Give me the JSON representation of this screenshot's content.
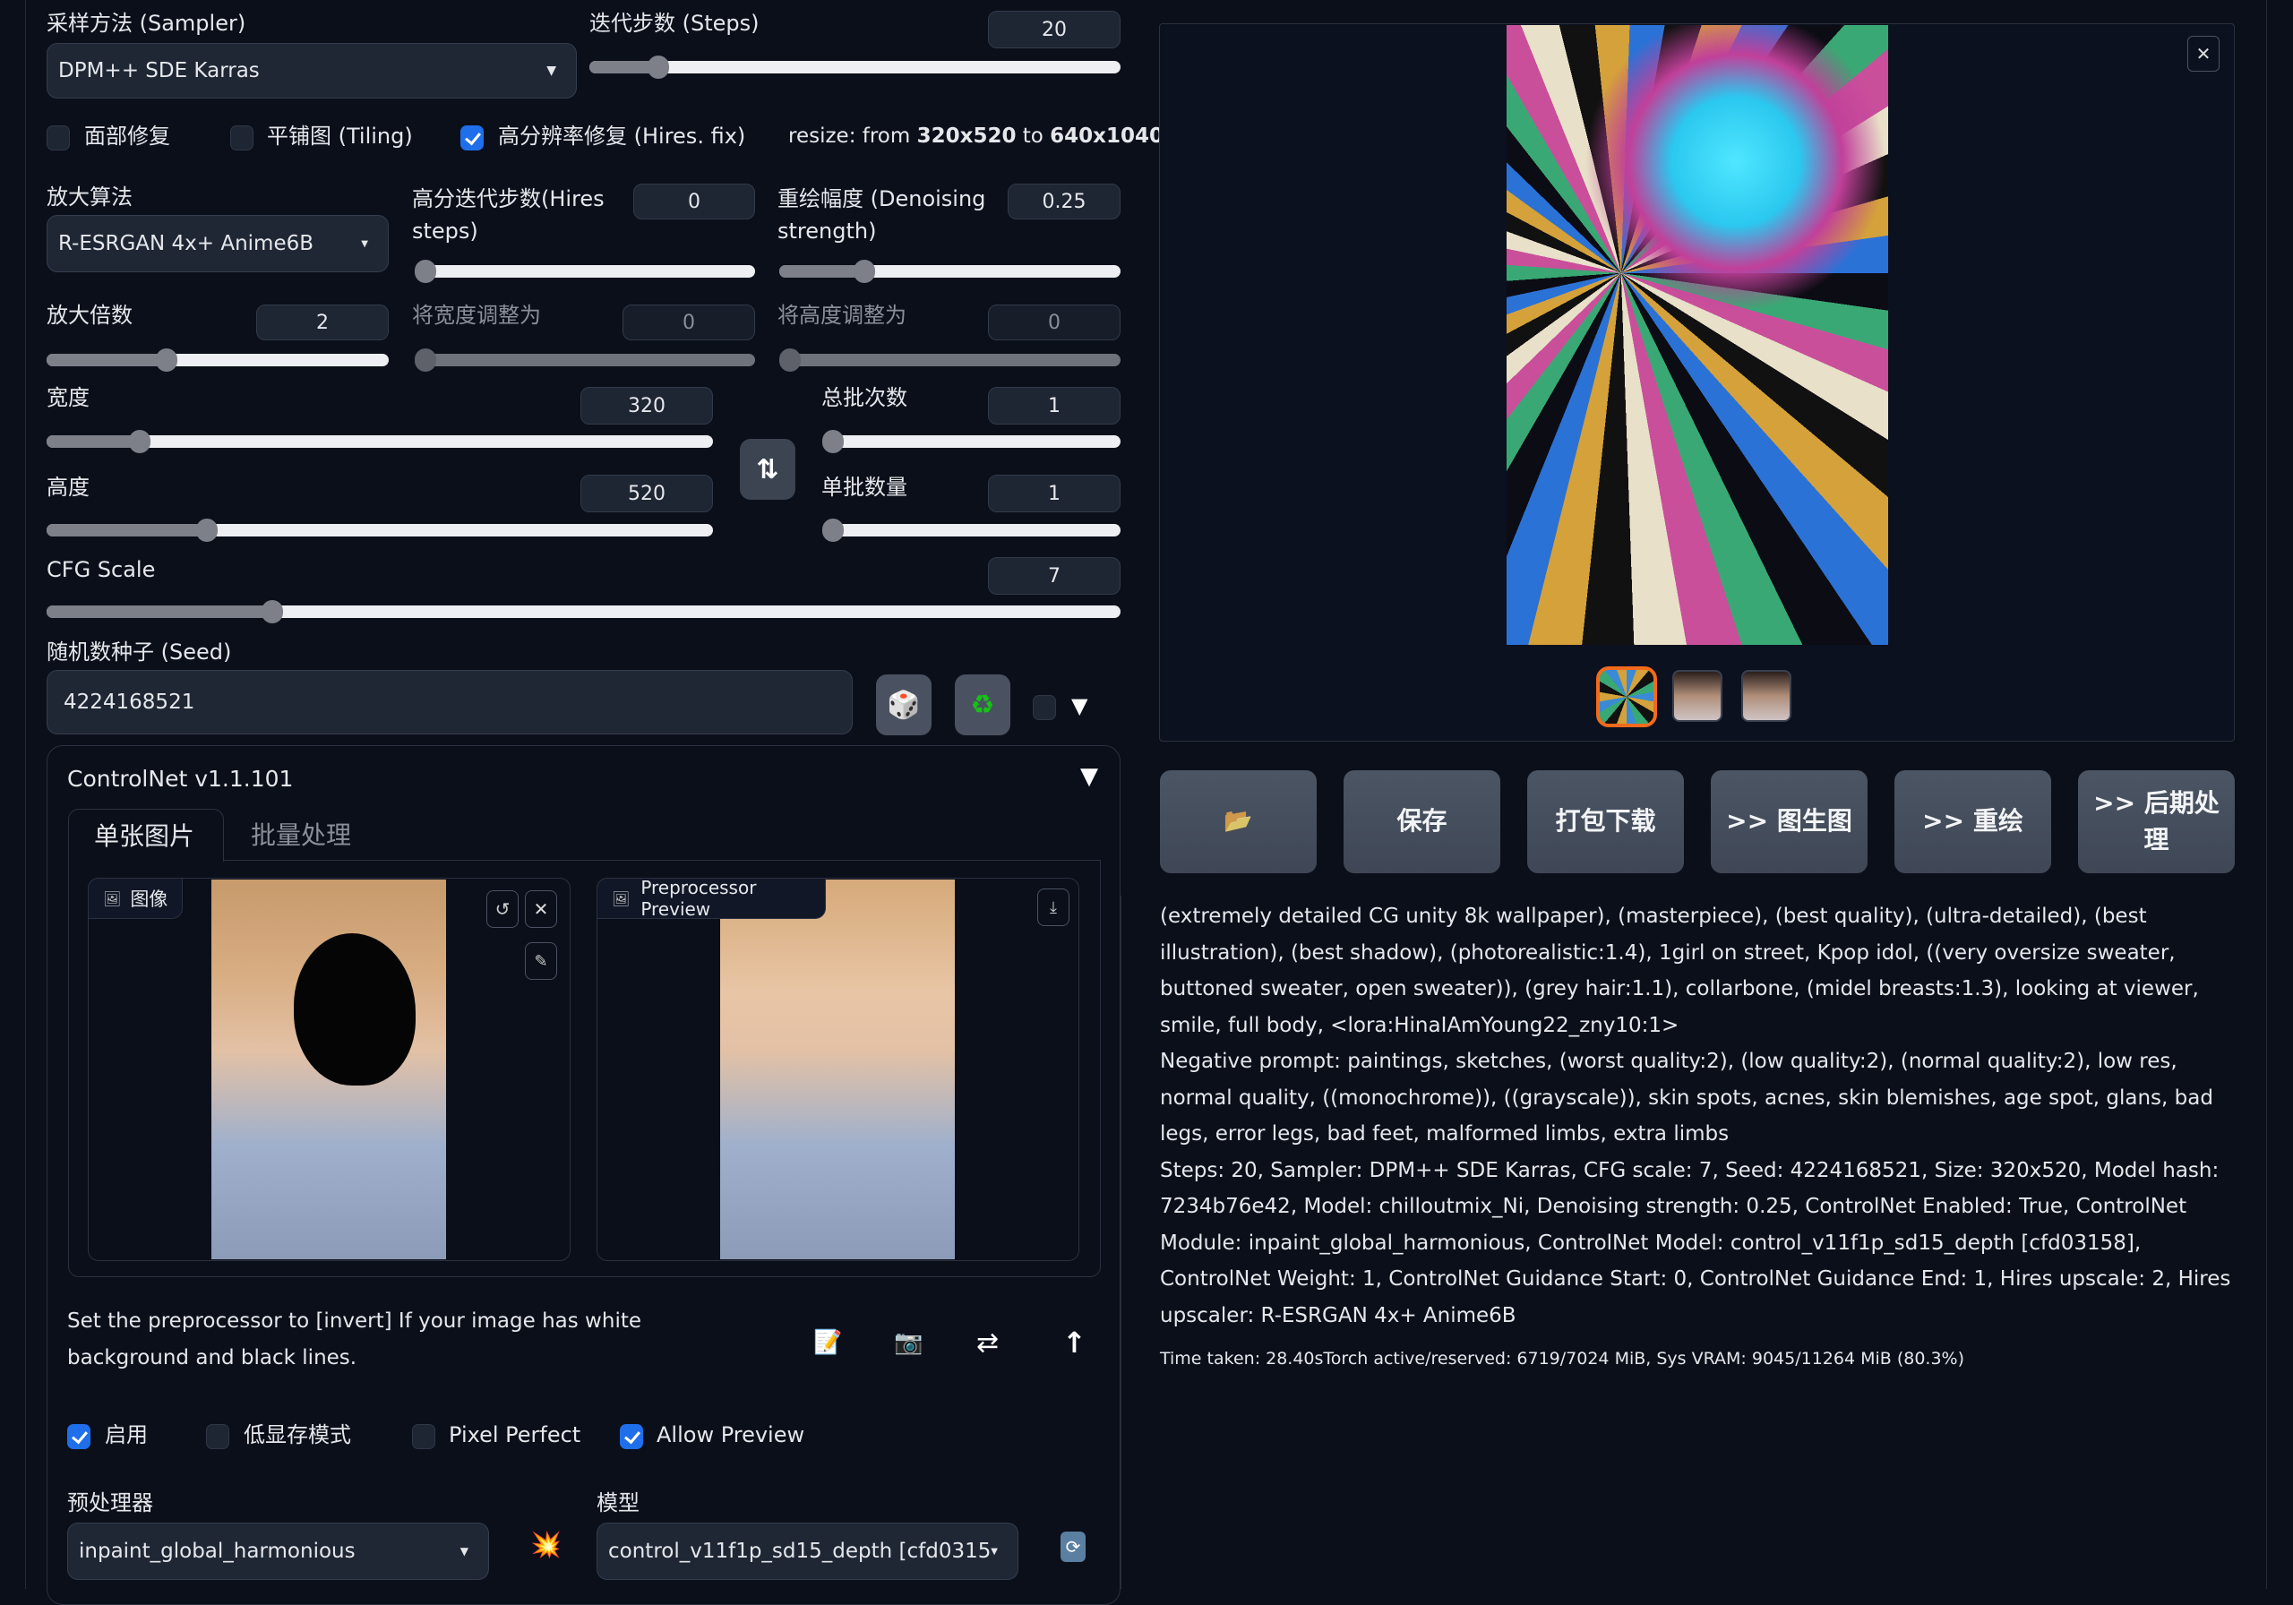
{
  "sampler": {
    "label": "采样方法 (Sampler)",
    "value": "DPM++ SDE Karras"
  },
  "steps": {
    "label": "迭代步数 (Steps)",
    "value": "20",
    "min": 1,
    "max": 150,
    "fraction": 0.13
  },
  "checkboxes_top": [
    {
      "label": "面部修复",
      "checked": false
    },
    {
      "label": "平铺图 (Tiling)",
      "checked": false
    },
    {
      "label": "高分辨率修复 (Hires. fix)",
      "checked": true
    }
  ],
  "resize_info": {
    "prefix": "resize: from ",
    "from": "320x520",
    "mid": " to ",
    "to": "640x1040"
  },
  "upscaler": {
    "label": "放大算法",
    "value": "R-ESRGAN 4x+ Anime6B"
  },
  "hires_steps": {
    "label": "高分迭代步数(Hires steps)",
    "value": "0",
    "fraction": 0.0
  },
  "denoising": {
    "label": "重绘幅度 (Denoising strength)",
    "value": "0.25",
    "fraction": 0.25
  },
  "upscale_by": {
    "label": "放大倍数",
    "value": "2",
    "fraction": 0.35
  },
  "resize_width_to": {
    "label": "将宽度调整为",
    "value": "0",
    "fraction": 0.0
  },
  "resize_height_to": {
    "label": "将高度调整为",
    "value": "0",
    "fraction": 0.0
  },
  "width": {
    "label": "宽度",
    "value": "320",
    "fraction": 0.14
  },
  "height": {
    "label": "高度",
    "value": "520",
    "fraction": 0.24
  },
  "batch_count": {
    "label": "总批次数",
    "value": "1",
    "fraction": 0.0
  },
  "batch_size": {
    "label": "单批数量",
    "value": "1",
    "fraction": 0.0
  },
  "swap_icon": "swap-dimensions-icon",
  "cfg": {
    "label": "CFG Scale",
    "value": "7",
    "fraction": 0.21
  },
  "seed": {
    "label": "随机数种子 (Seed)",
    "value": "4224168521",
    "random_icon": "dice-icon",
    "reuse_icon": "recycle-icon",
    "extra_checked": false
  },
  "controlnet": {
    "title": "ControlNet v1.1.101",
    "tabs": [
      {
        "label": "单张图片",
        "active": true
      },
      {
        "label": "批量处理",
        "active": false
      }
    ],
    "image_label": "图像",
    "preview_label": "Preprocessor Preview",
    "hint": "Set the preprocessor to [invert] If your image has white background and black lines.",
    "tool_icons": [
      "edit-canvas-icon",
      "camera-icon",
      "swap-icon",
      "send-size-icon"
    ],
    "options": [
      {
        "label": "启用",
        "checked": true
      },
      {
        "label": "低显存模式",
        "checked": false
      },
      {
        "label": "Pixel Perfect",
        "checked": false
      },
      {
        "label": "Allow Preview",
        "checked": true
      }
    ],
    "preprocessor": {
      "label": "预处理器",
      "value": "inpaint_global_harmonious"
    },
    "model": {
      "label": "模型",
      "value": "control_v11f1p_sd15_depth [cfd0315"
    }
  },
  "gallery": {
    "thumbnails": [
      {
        "selected": true
      },
      {
        "selected": false
      },
      {
        "selected": false
      }
    ]
  },
  "actions": [
    {
      "label": "📂",
      "name": "open-folder-button"
    },
    {
      "label": "保存",
      "name": "save-button"
    },
    {
      "label": "打包下载",
      "name": "zip-download-button"
    },
    {
      "label": ">> 图生图",
      "name": "send-to-img2img-button"
    },
    {
      "label": ">> 重绘",
      "name": "send-to-inpaint-button"
    },
    {
      "label": ">> 后期处理",
      "name": "send-to-extras-button"
    }
  ],
  "generation_info": {
    "prompt": "(extremely detailed CG unity 8k wallpaper), (masterpiece), (best quality), (ultra-detailed), (best illustration), (best shadow), (photorealistic:1.4), 1girl on street, Kpop idol, ((very oversize sweater, buttoned sweater, open sweater)), (grey hair:1.1), collarbone, (midel breasts:1.3), looking at viewer, smile, full body, <lora:HinaIAmYoung22_zny10:1>",
    "negative": "Negative prompt: paintings, sketches, (worst quality:2), (low quality:2), (normal quality:2), low res, normal quality, ((monochrome)), ((grayscale)), skin spots, acnes, skin blemishes, age spot, glans, bad legs, error legs, bad feet, malformed limbs, extra limbs",
    "params": "Steps: 20, Sampler: DPM++ SDE Karras, CFG scale: 7, Seed: 4224168521, Size: 320x520, Model hash: 7234b76e42, Model: chilloutmix_Ni, Denoising strength: 0.25, ControlNet Enabled: True, ControlNet Module: inpaint_global_harmonious, ControlNet Model: control_v11f1p_sd15_depth [cfd03158], ControlNet Weight: 1, ControlNet Guidance Start: 0, ControlNet Guidance End: 1, Hires upscale: 2, Hires upscaler: R-ESRGAN 4x+ Anime6B",
    "timing": "Time taken: 28.40sTorch active/reserved: 6719/7024 MiB, Sys VRAM: 9045/11264 MiB (80.3%)"
  },
  "colors": {
    "accent": "#1f6feb",
    "selected_thumb": "#f26b1d",
    "background": "#0b0f1a"
  }
}
